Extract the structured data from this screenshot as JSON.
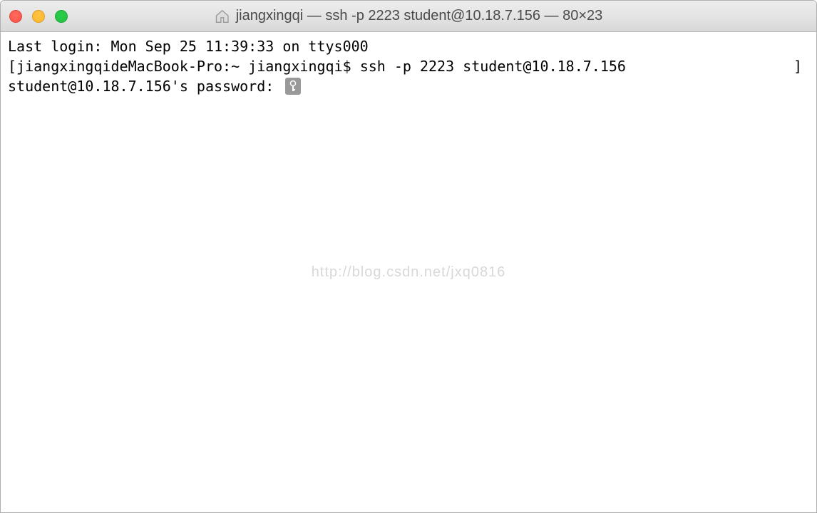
{
  "titlebar": {
    "title": "jiangxingqi — ssh -p 2223 student@10.18.7.156 — 80×23"
  },
  "terminal": {
    "last_login": "Last login: Mon Sep 25 11:39:33 on ttys000",
    "prompt_left_bracket": "[",
    "prompt_host": "jiangxingqideMacBook-Pro:~ jiangxingqi$ ",
    "command": "ssh -p 2223 student@10.18.7.156",
    "prompt_right_bracket": "]",
    "password_prompt": "student@10.18.7.156's password: "
  },
  "watermark": "http://blog.csdn.net/jxq0816"
}
